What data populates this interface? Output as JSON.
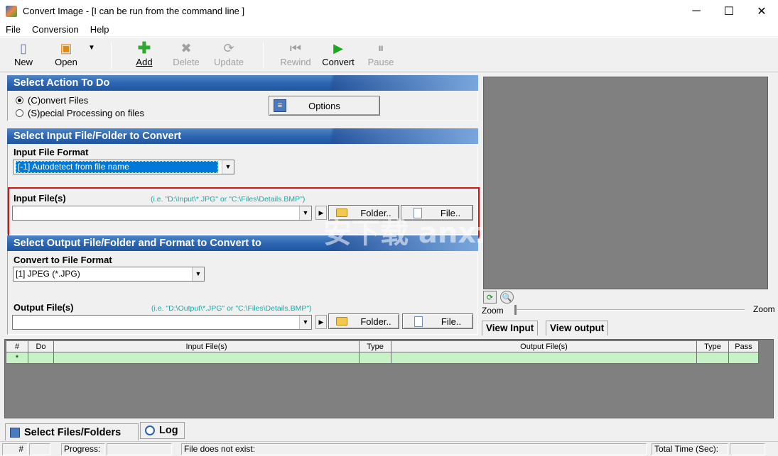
{
  "window": {
    "title": "Convert Image - [I can be run from the command line ]",
    "controls": [
      "─",
      "☐",
      "✕"
    ]
  },
  "menu": [
    "File",
    "Conversion",
    "Help"
  ],
  "toolbar": {
    "new": "New",
    "open": "Open",
    "add": "Add",
    "delete": "Delete",
    "update": "Update",
    "rewind": "Rewind",
    "convert": "Convert",
    "pause": "Pause"
  },
  "action_section": {
    "header": "Select Action To Do",
    "radio_convert": "(C)onvert Files",
    "radio_special": "(S)pecial Processing on files",
    "options_button": "Options"
  },
  "input_section": {
    "header": "Select Input File/Folder to Convert",
    "format_label": "Input File Format",
    "format_value": "[-1] Autodetect from file name",
    "files_label": "Input File(s)",
    "files_hint": "(i.e. \"D:\\Input\\*.JPG\" or \"C:\\Files\\Details.BMP\")",
    "folder_button": "Folder..",
    "file_button": "File.."
  },
  "output_section": {
    "header": "Select Output File/Folder and Format to Convert to",
    "format_label": "Convert to File Format",
    "format_value": "[1] JPEG (*.JPG)",
    "files_label": "Output File(s)",
    "files_hint": "(i.e. \"D:\\Output\\*.JPG\" or \"C:\\Files\\Details.BMP\")",
    "folder_button": "Folder..",
    "file_button": "File.."
  },
  "preview": {
    "zoom_left": "Zoom",
    "zoom_right": "Zoom",
    "view_input_tab": "View Input",
    "view_output_tab": "View output"
  },
  "grid": {
    "columns": [
      "#",
      "Do",
      "Input File(s)",
      "Type",
      "Output File(s)",
      "Type",
      "Pass"
    ],
    "new_row_marker": "*"
  },
  "bottom_tabs": {
    "select_files": "Select Files/Folders",
    "log": "Log"
  },
  "status": {
    "hash": "#",
    "progress": "Progress:",
    "message": "File does not exist:",
    "total_time": "Total Time (Sec):"
  },
  "watermark": "安下载 anxz.com"
}
